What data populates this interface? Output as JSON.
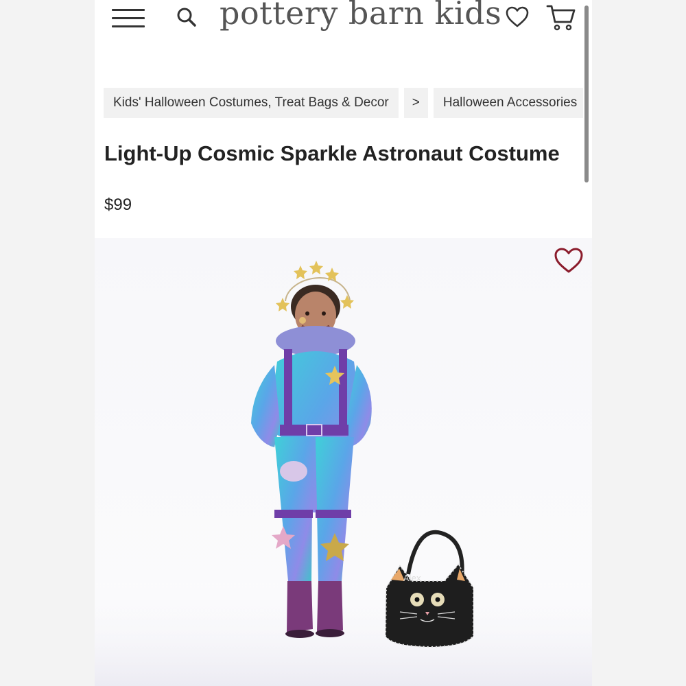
{
  "header": {
    "logo_text": "pottery barn kids",
    "icons": {
      "menu": "hamburger-menu-icon",
      "search": "search-icon",
      "wishlist": "heart-icon",
      "cart": "cart-icon"
    }
  },
  "breadcrumb": {
    "items": [
      "Kids' Halloween Costumes, Treat Bags & Decor",
      ">",
      "Halloween Accessories"
    ]
  },
  "product": {
    "title": "Light-Up Cosmic Sparkle Astronaut Costume",
    "price": "$99",
    "bag_name": "Alex"
  },
  "colors": {
    "favorite_heart": "#8b1c2c",
    "text": "#222222",
    "breadcrumb_bg": "#f1f1f1"
  }
}
